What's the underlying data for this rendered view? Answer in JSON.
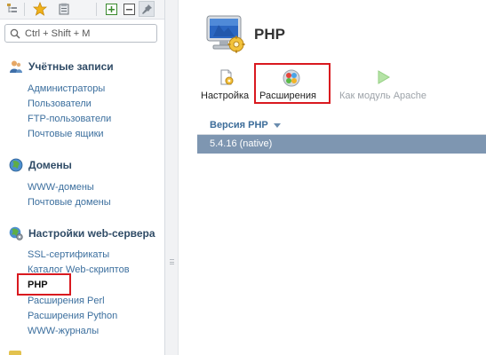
{
  "sidebar": {
    "toolbar_icons": [
      "tree-view-icon",
      "favorites-star-icon",
      "archive-icon",
      "expand-plus-icon",
      "collapse-minus-icon",
      "pin-icon"
    ],
    "search": {
      "placeholder": "Ctrl + Shift + M",
      "value": ""
    },
    "sections": [
      {
        "title": "Учётные записи",
        "icon": "users-icon",
        "items": [
          "Администраторы",
          "Пользователи",
          "FTP-пользователи",
          "Почтовые ящики"
        ]
      },
      {
        "title": "Домены",
        "icon": "globe-icon",
        "items": [
          "WWW-домены",
          "Почтовые домены"
        ]
      },
      {
        "title": "Настройки web-сервера",
        "icon": "globe-gear-icon",
        "items": [
          "SSL-сертификаты",
          "Каталог Web-скриптов",
          "PHP",
          "Расширения Perl",
          "Расширения Python",
          "WWW-журналы"
        ],
        "active_item": "PHP"
      }
    ]
  },
  "main": {
    "title": "PHP",
    "toolbar": {
      "settings_label": "Настройка",
      "extensions_label": "Расширения",
      "apache_module_label": "Как модуль Apache"
    },
    "grid": {
      "column_header": "Версия PHP",
      "rows": [
        "5.4.16 (native)"
      ]
    }
  },
  "colors": {
    "highlight_box": "#d9191f",
    "selected_row": "#7e96b1",
    "link": "#3c6f9e",
    "section_title": "#2f4b66"
  }
}
